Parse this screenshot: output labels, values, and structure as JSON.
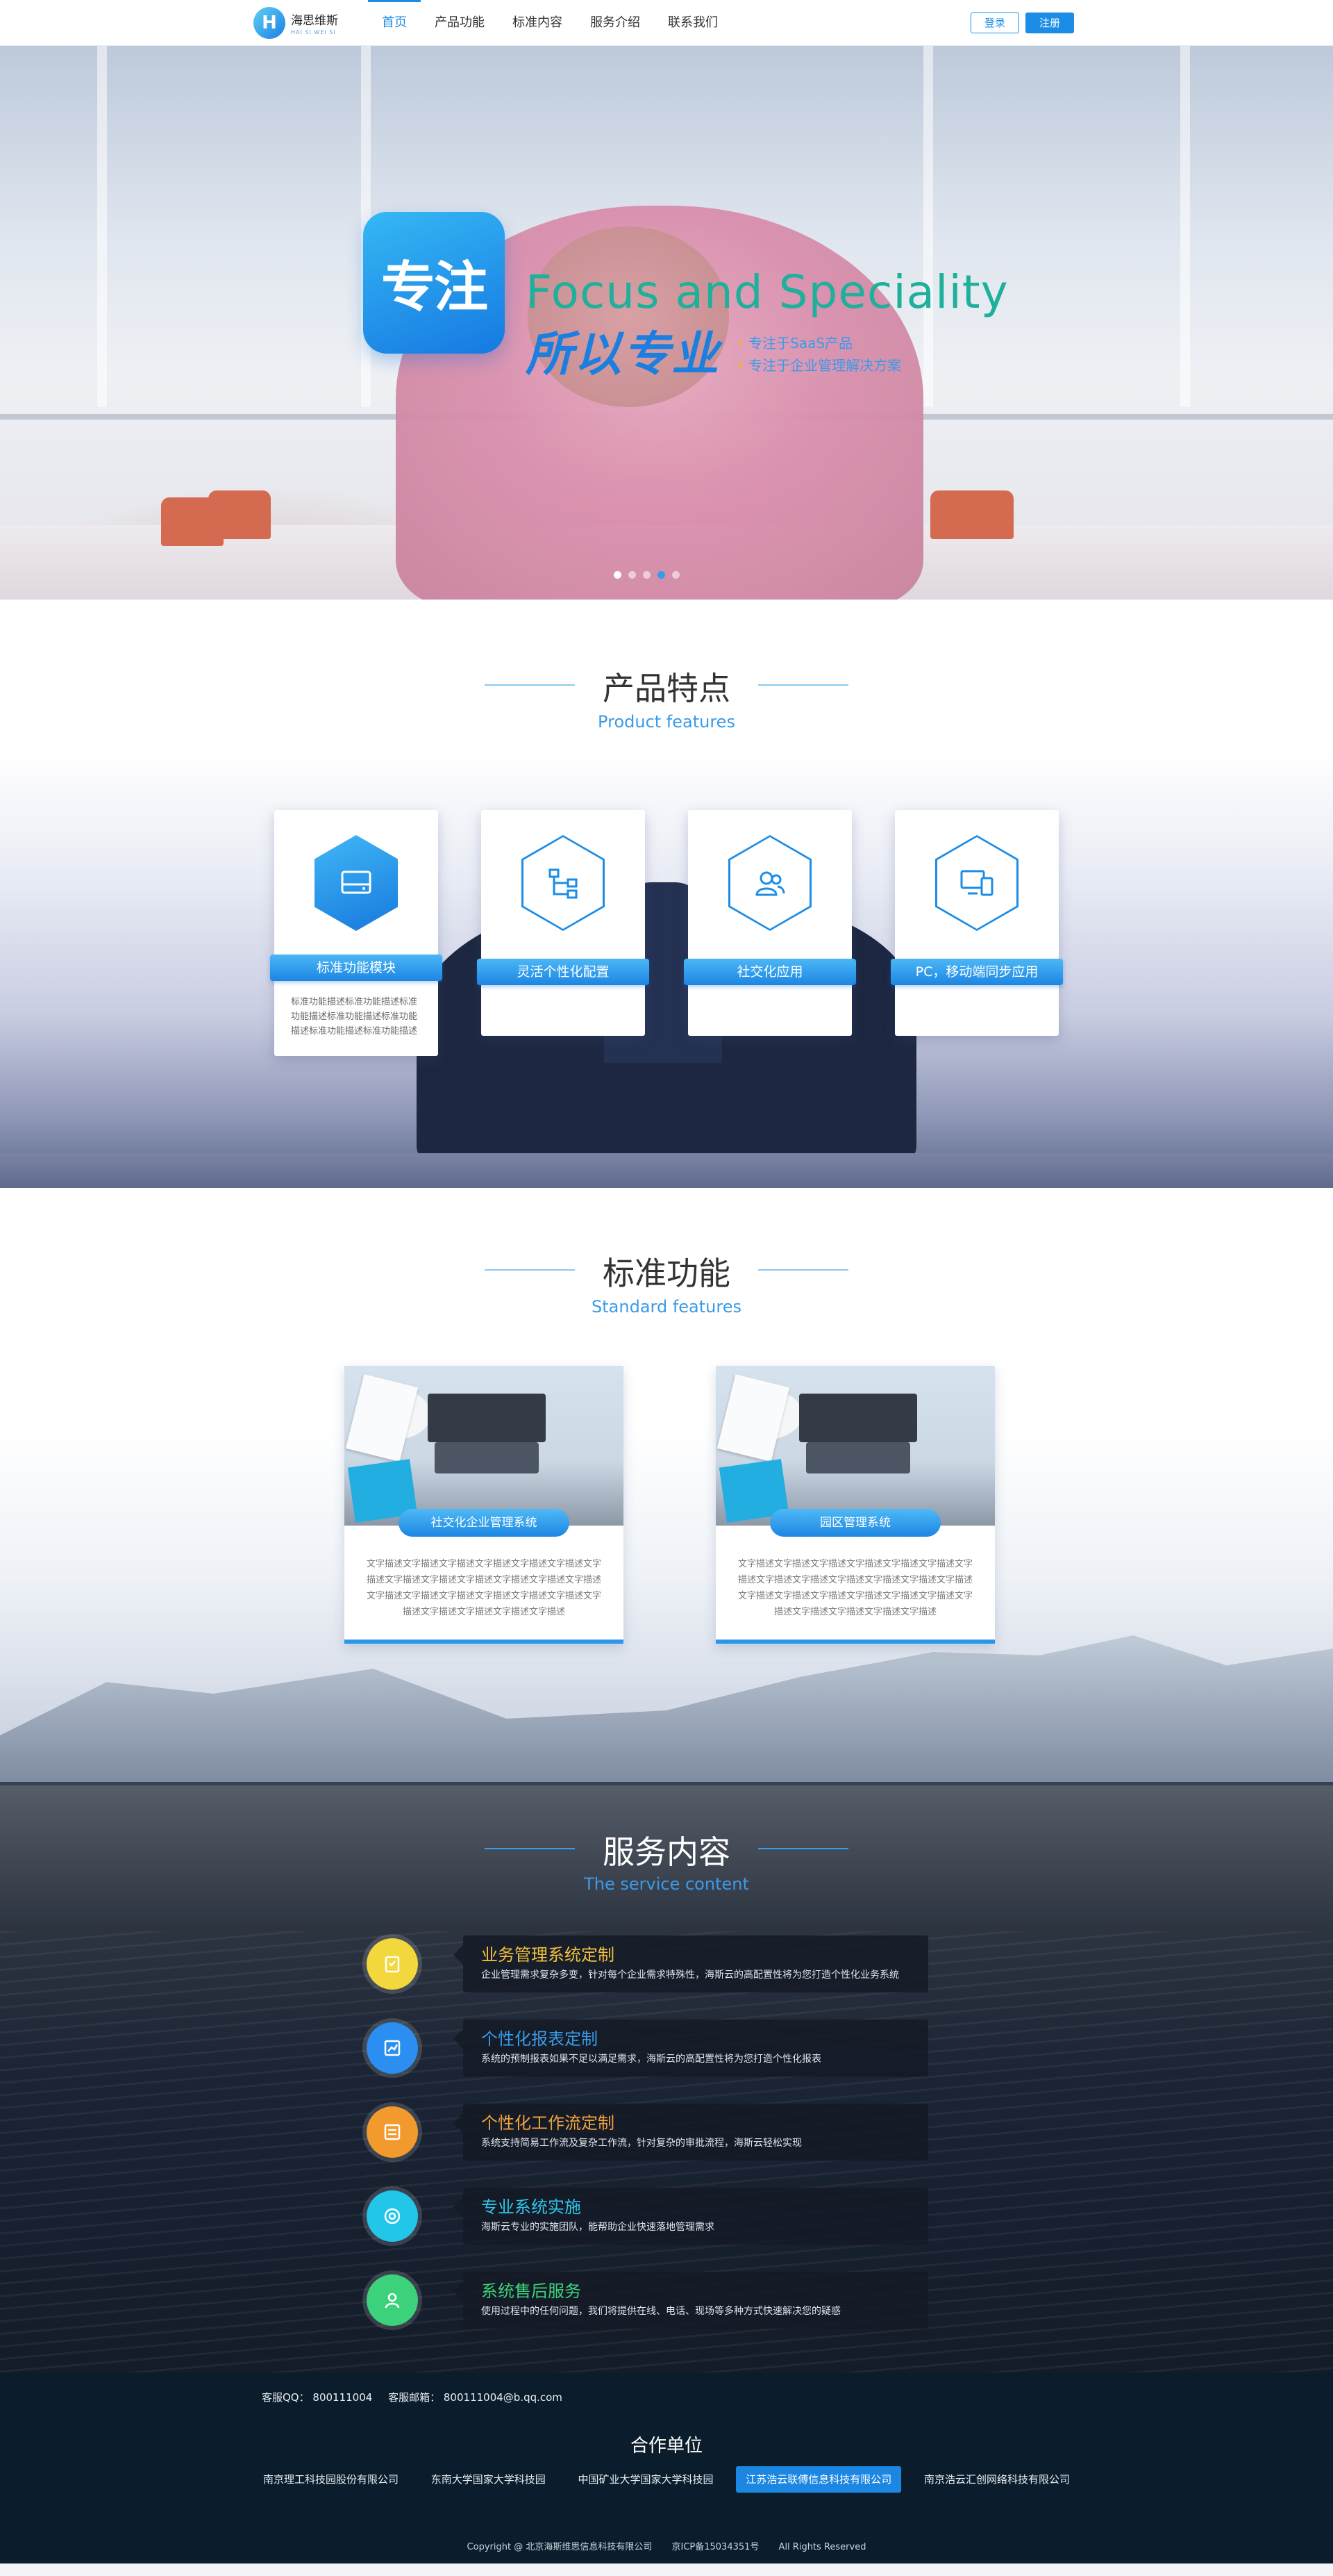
{
  "header": {
    "logo_cn": "海思维斯",
    "logo_en": "HAI SI WEI SI",
    "nav": [
      "首页",
      "产品功能",
      "标准内容",
      "服务介绍",
      "联系我们"
    ],
    "login": "登录",
    "register": "注册"
  },
  "hero": {
    "badge": "专注",
    "en_part1": "Focus",
    "en_part2": "and",
    "en_part3": "Speciality",
    "cn": "所以专业",
    "bullets": [
      "专注于SaaS产品",
      "专注于企业管理解决方案"
    ],
    "slides_total": 5,
    "slide_active": 1
  },
  "features": {
    "title_cn": "产品特点",
    "title_en": "Product features",
    "cards": [
      {
        "label": "标准功能模块",
        "icon": "hard-drive-icon",
        "desc": "标准功能描述标准功能描述标准功能描述标准功能描述标准功能描述标准功能描述标准功能描述"
      },
      {
        "label": "灵活个性化配置",
        "icon": "hierarchy-icon"
      },
      {
        "label": "社交化应用",
        "icon": "users-icon"
      },
      {
        "label": "PC，移动端同步应用",
        "icon": "devices-icon"
      }
    ]
  },
  "standard": {
    "title_cn": "标准功能",
    "title_en": "Standard features",
    "cards": [
      {
        "label": "社交化企业管理系统",
        "desc": "文字描述文字描述文字描述文字描述文字描述文字描述文字描述文字描述文字描述文字描述文字描述文字描述文字描述文字描述文字描述文字描述文字描述文字描述文字描述文字描述文字描述文字描述文字描述文字描述"
      },
      {
        "label": "园区管理系统",
        "desc": "文字描述文字描述文字描述文字描述文字描述文字描述文字描述文字描述文字描述文字描述文字描述文字描述文字描述文字描述文字描述文字描述文字描述文字描述文字描述文字描述文字描述文字描述文字描述文字描述"
      }
    ]
  },
  "services": {
    "title_cn": "服务内容",
    "title_en": "The service content",
    "items": [
      {
        "name": "业务管理系统定制",
        "desc": "企业管理需求复杂多变，针对每个企业需求特殊性，海斯云的高配置性将为您打造个性化业务系统",
        "color": "#f2d83d",
        "name_color": "#f2c13d",
        "icon": "clipboard-icon"
      },
      {
        "name": "个性化报表定制",
        "desc": "系统的预制报表如果不足以满足需求，海斯云的高配置性将为您打造个性化报表",
        "color": "#2a8ff0",
        "name_color": "#3a9be8",
        "icon": "chart-icon"
      },
      {
        "name": "个性化工作流定制",
        "desc": "系统支持简易工作流及复杂工作流，针对复杂的审批流程，海斯云轻松实现",
        "color": "#f29a2e",
        "name_color": "#f2a33d",
        "icon": "workflow-icon"
      },
      {
        "name": "专业系统实施",
        "desc": "海斯云专业的实施团队，能帮助企业快速落地管理需求",
        "color": "#22c6e8",
        "name_color": "#2fc6e8",
        "icon": "target-icon"
      },
      {
        "name": "系统售后服务",
        "desc": "使用过程中的任何问题，我们将提供在线、电话、现场等多种方式快速解决您的疑惑",
        "color": "#3cd27c",
        "name_color": "#3cd27c",
        "icon": "support-icon"
      }
    ]
  },
  "footer": {
    "qq_label": "客服QQ：",
    "qq": "800111004",
    "email_label": "客服邮箱：",
    "email": "800111004@b.qq.com",
    "partners_title": "合作单位",
    "partners": [
      "南京理工科技园股份有限公司",
      "东南大学国家大学科技园",
      "中国矿业大学国家大学科技园",
      "江苏浩云联傅信息科技有限公司",
      "南京浩云汇创网络科技有限公司"
    ],
    "copyright": "Copyright @ 北京海斯维思信息科技有限公司",
    "icp": "京ICP备15034351号",
    "rights": "All Rights Reserved"
  }
}
